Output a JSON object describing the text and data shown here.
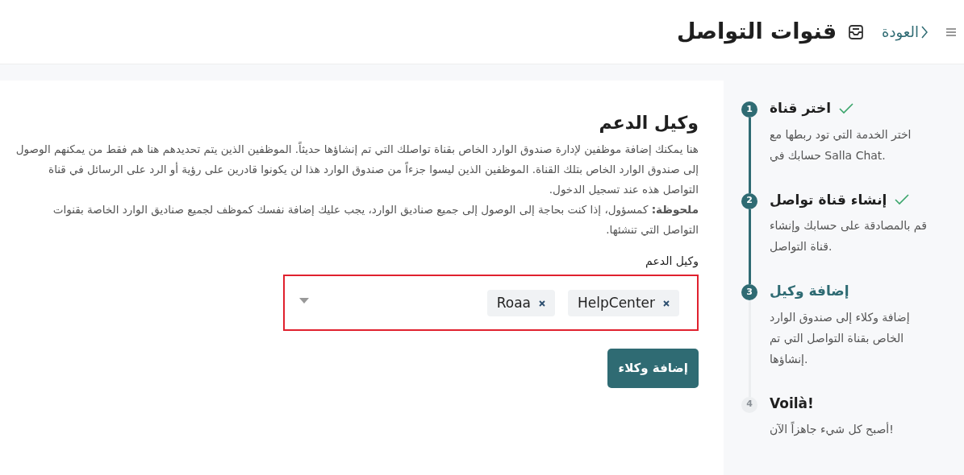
{
  "header": {
    "back_link": "العودة",
    "title": "قنوات التواصل"
  },
  "form": {
    "heading": "وكيل الدعم",
    "description": "هنا يمكنك إضافة موظفين لإدارة صندوق الوارد الخاص بقناة تواصلك التي تم إنشاؤها حديثاً. الموظفين الذين يتم تحديدهم هنا هم فقط من يمكنهم الوصول إلى صندوق الوارد الخاص بتلك القناة. الموظفين الذين ليسوا جزءاً من صندوق الوارد هذا لن يكونوا قادرين على رؤية أو الرد على الرسائل في قناة التواصل هذه عند تسجيل الدخول.",
    "note": "**ملحوظة:** كمسؤول، إذا كنت بحاجة إلى الوصول إلى جميع صناديق الوارد، يجب عليك إضافة نفسك كموظف لجميع صناديق الوارد الخاصة بقنوات التواصل التي تنشئها.",
    "field_label": "وكيل الدعم",
    "field_invalid": true,
    "tags": [
      {
        "label": "HelpCenter"
      },
      {
        "label": "Roaa"
      }
    ],
    "button": "إضافة وكلاء"
  },
  "steps": [
    {
      "number": "1",
      "title": "اختر قناة",
      "completed": true,
      "selected": false,
      "description": "اختر الخدمة التي تود ربطها مع حسابك في Salla Chat."
    },
    {
      "number": "2",
      "title": "إنشاء قناة تواصل",
      "completed": true,
      "selected": false,
      "description": "قم بالمصادقة على حسابك وإنشاء قناة التواصل."
    },
    {
      "number": "3",
      "title": "إضافة وكيل",
      "completed": false,
      "selected": true,
      "description": "إضافة وكلاء إلى صندوق الوارد الخاص بقناة التواصل التي تم إنشاؤها."
    },
    {
      "number": "4",
      "title": "Voilà!",
      "completed": false,
      "selected": false,
      "description": "أصبح كل شيء جاهزاً الآن!"
    }
  ]
}
